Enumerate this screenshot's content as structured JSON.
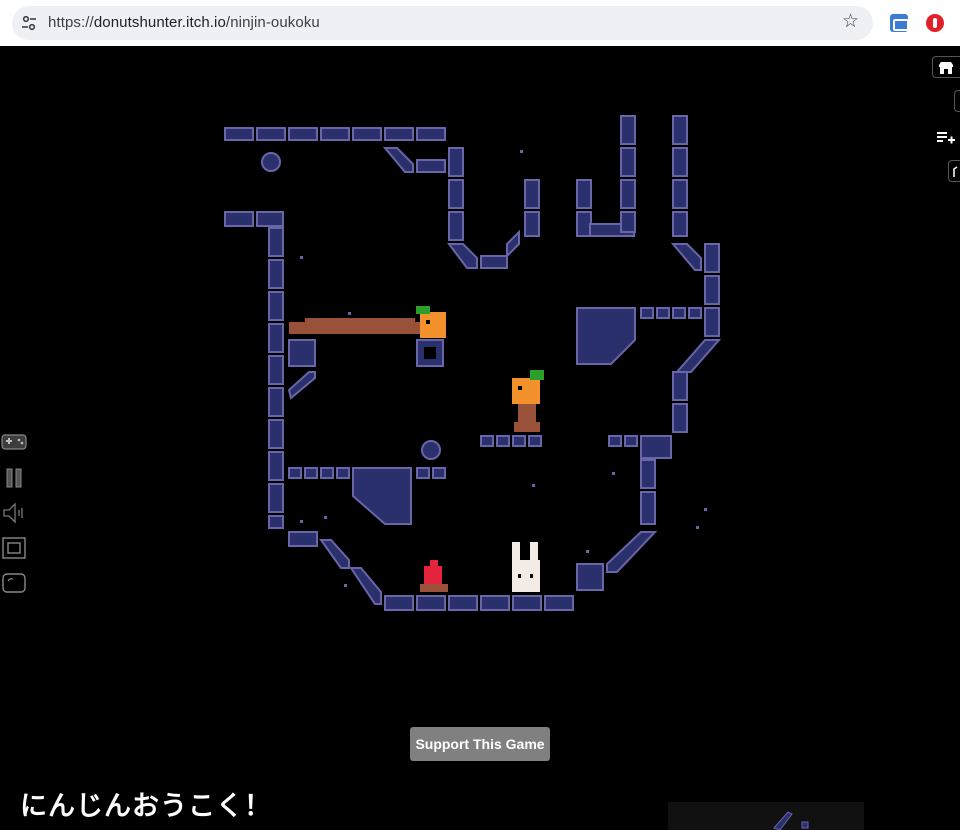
{
  "browser": {
    "url_scheme": "https://",
    "url_host": "donutshunter.itch.io",
    "url_path": "/ninjin-oukoku",
    "bookmark_icon": "star-icon",
    "site_info_icon": "tune-icon",
    "extensions": [
      "screen-extension-icon",
      "adblock-extension-icon"
    ]
  },
  "itch_sidebar": {
    "buttons": [
      "itch-store-icon",
      "collapse-icon",
      "add-to-collection-icon",
      "share-icon"
    ]
  },
  "player_controls": [
    "gamepad-icon",
    "pause-icon",
    "volume-icon",
    "fullscreen-icon",
    "screenshot-icon"
  ],
  "colors": {
    "wall": "#29306b",
    "wall_edge": "#6a64a8",
    "platform": "#9a513a",
    "carrot": "#f3912c",
    "leaf": "#2aa02a",
    "rabbit": "#f3ebe6",
    "fire": "#e5243e"
  },
  "support_button": "Support This Game",
  "game_title": "にんじんおうこく！"
}
